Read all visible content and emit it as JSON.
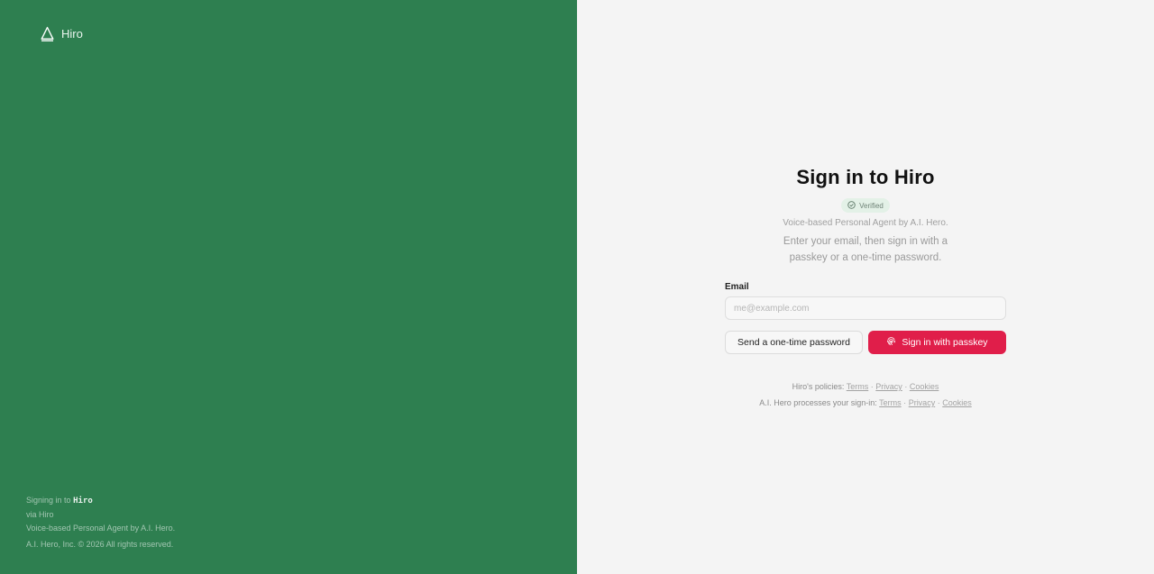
{
  "brand": {
    "name": "Hiro",
    "logo_icon": "triangle-logo-icon",
    "footer": {
      "signing_prefix": "Signing in to",
      "app_code": "Hiro",
      "via": "via Hiro",
      "description": "Voice-based Personal Agent by A.I. Hero.",
      "copyright": "A.I. Hero, Inc. © 2026 All rights reserved."
    },
    "background_color": "#2e7f50"
  },
  "signin": {
    "title": "Sign in to Hiro",
    "badge": {
      "label": "Verified",
      "icon": "check-circle-icon"
    },
    "subtitle": "Voice-based Personal Agent by A.I. Hero.",
    "instructions": "Enter your email, then sign in with a passkey or a one-time password.",
    "email": {
      "label": "Email",
      "placeholder": "me@example.com",
      "value": ""
    },
    "buttons": {
      "otp_label": "Send a one-time password",
      "passkey_label": "Sign in with passkey",
      "passkey_icon": "fingerprint-icon",
      "passkey_color": "#e01e4a"
    },
    "policies": {
      "hiro_prefix": "Hiro's policies:",
      "aihero_prefix": "A.I. Hero processes your sign-in:",
      "terms": "Terms",
      "privacy": "Privacy",
      "cookies": "Cookies",
      "separator": "·"
    }
  }
}
